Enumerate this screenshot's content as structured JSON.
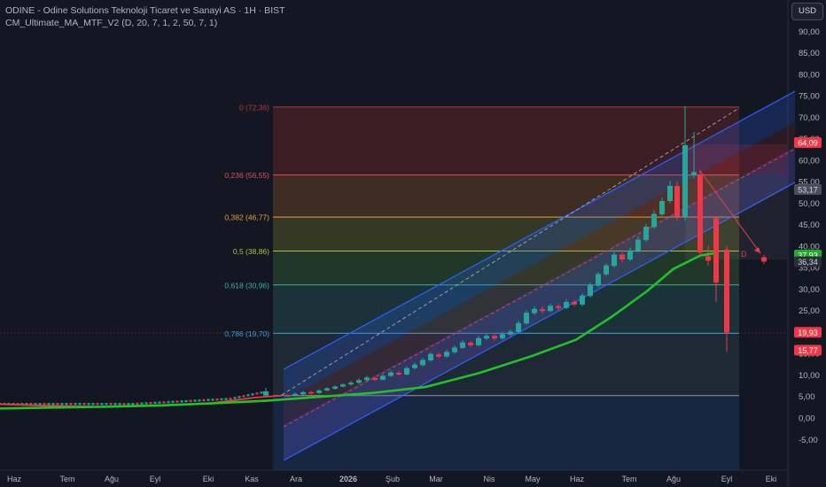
{
  "header": {
    "title": "ODINE - Odine Solutions Teknoloji Ticaret ve Sanayi AS · 1H · BIST",
    "indicator": "CM_Ultimate_MA_MTF_V2 (D, 20, 7, 1, 2, 50, 7, 1)"
  },
  "currency_button": "USD",
  "colors": {
    "background": "#131722",
    "up_candle": "#26a69a",
    "down_candle": "#f23645",
    "ma_line": "#22c12a",
    "channel": "#2962ff",
    "axis_text": "#b2b5be"
  },
  "chart_data": {
    "type": "candlestick",
    "x_axis_labels": [
      "Haz",
      "Tem",
      "Ağu",
      "Eyl",
      "Eki",
      "Kas",
      "Ara",
      "2026",
      "Şub",
      "Mar",
      "Nis",
      "May",
      "Haz",
      "Tem",
      "Ağu",
      "Eyl",
      "Eki"
    ],
    "y_ticks": [
      "90,00",
      "85,00",
      "80,00",
      "75,00",
      "70,00",
      "65,00",
      "60,00",
      "55,00",
      "50,00",
      "45,00",
      "40,00",
      "35,00",
      "30,00",
      "25,00",
      "20,00",
      "15,00",
      "10,00",
      "5,00",
      "0,00",
      "-5,00"
    ],
    "ylim": [
      -8,
      95
    ],
    "fib_levels": [
      {
        "label": "0 (72,36)",
        "value": 72.36,
        "color": "#b23a3a"
      },
      {
        "label": "0,236 (56,55)",
        "value": 56.55,
        "color": "#e05252"
      },
      {
        "label": "0,382 (46,77)",
        "value": 46.77,
        "color": "#e5a03a"
      },
      {
        "label": "0,5 (38,86)",
        "value": 38.86,
        "color": "#a3c43c"
      },
      {
        "label": "0,618 (30,96)",
        "value": 30.96,
        "color": "#3cb29a"
      },
      {
        "label": "0,786 (19,70)",
        "value": 19.7,
        "color": "#3c9ed6"
      },
      {
        "label": "",
        "value": 5.2,
        "color": "#9598a1"
      }
    ],
    "price_labels": [
      {
        "text": "64,09",
        "value": 64.09,
        "bg": "#f23645",
        "fg": "#ffffff"
      },
      {
        "text": "53,17",
        "value": 53.17,
        "bg": "#4a4f5c",
        "fg": "#d1d4dc"
      },
      {
        "text": "37,93",
        "value": 37.93,
        "bg": "#22ab2a",
        "fg": "#ffffff"
      },
      {
        "text": "36,34",
        "value": 36.34,
        "bg": "#2a2e39",
        "fg": "#d1d4dc"
      },
      {
        "text": "19,93",
        "value": 19.93,
        "bg": "#f23645",
        "fg": "#ffffff"
      },
      {
        "text": "15,77",
        "value": 15.77,
        "bg": "#f23645",
        "fg": "#ffffff"
      }
    ],
    "annotation": "D"
  }
}
